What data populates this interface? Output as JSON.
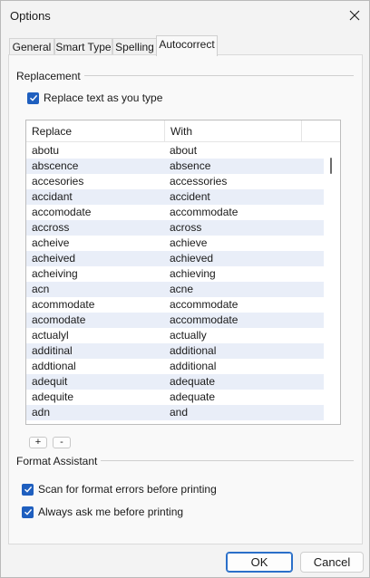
{
  "window": {
    "title": "Options",
    "close_icon": "close-icon"
  },
  "tabs": [
    {
      "label": "General",
      "active": false
    },
    {
      "label": "Smart Type",
      "active": false
    },
    {
      "label": "Spelling",
      "active": false
    },
    {
      "label": "Autocorrect",
      "active": true
    }
  ],
  "replacement_group": {
    "title": "Replacement",
    "replace_as_you_type": {
      "label": "Replace text as you type",
      "checked": true
    }
  },
  "list": {
    "columns": [
      "Replace",
      "With"
    ],
    "rows": [
      {
        "replace": "abotu",
        "with": "about"
      },
      {
        "replace": "abscence",
        "with": "absence"
      },
      {
        "replace": "accesories",
        "with": "accessories"
      },
      {
        "replace": "accidant",
        "with": "accident"
      },
      {
        "replace": "accomodate",
        "with": "accommodate"
      },
      {
        "replace": "accross",
        "with": "across"
      },
      {
        "replace": "acheive",
        "with": "achieve"
      },
      {
        "replace": "acheived",
        "with": "achieved"
      },
      {
        "replace": "acheiving",
        "with": "achieving"
      },
      {
        "replace": "acn",
        "with": "acne"
      },
      {
        "replace": "acommodate",
        "with": "accommodate"
      },
      {
        "replace": "acomodate",
        "with": "accommodate"
      },
      {
        "replace": "actualyl",
        "with": "actually"
      },
      {
        "replace": "additinal",
        "with": "additional"
      },
      {
        "replace": "addtional",
        "with": "additional"
      },
      {
        "replace": "adequit",
        "with": "adequate"
      },
      {
        "replace": "adequite",
        "with": "adequate"
      },
      {
        "replace": "adn",
        "with": "and"
      }
    ]
  },
  "list_buttons": {
    "add": "+",
    "remove": "-"
  },
  "format_group": {
    "title": "Format Assistant",
    "scan_errors": {
      "label": "Scan for format errors before printing",
      "checked": true
    },
    "always_ask": {
      "label": "Always ask me before printing",
      "checked": true
    }
  },
  "footer": {
    "ok": "OK",
    "cancel": "Cancel"
  },
  "colors": {
    "accent": "#1f5fbf",
    "alt_row": "#e9eef8"
  }
}
